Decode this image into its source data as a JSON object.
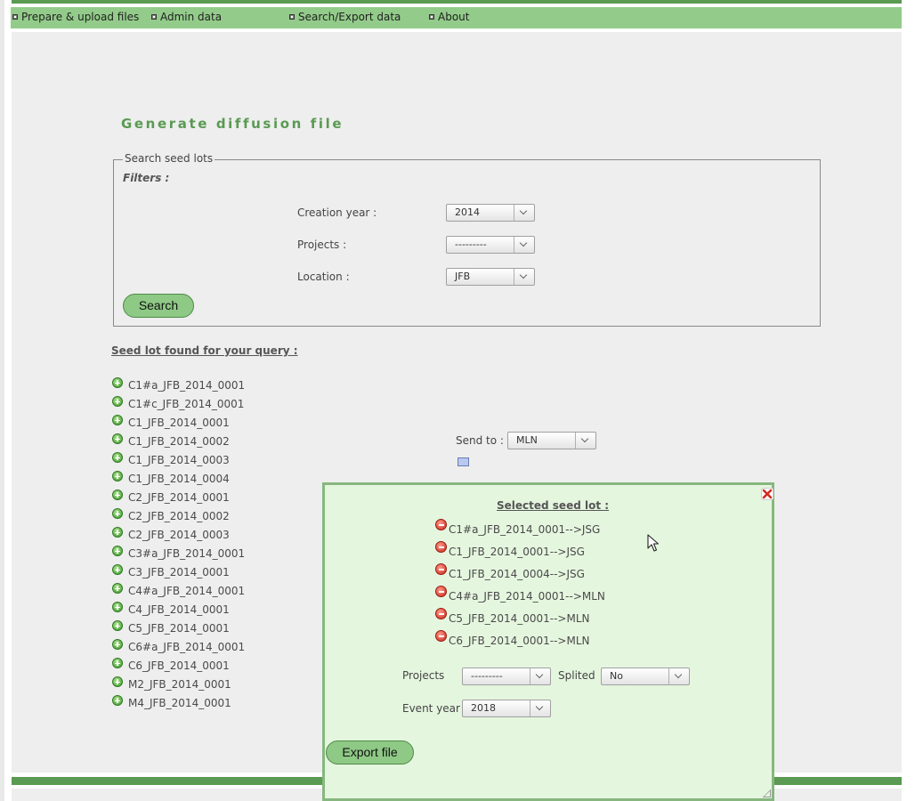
{
  "menu": {
    "items": [
      {
        "label": "Prepare & upload files"
      },
      {
        "label": "Admin data"
      },
      {
        "label": "Search/Export data"
      },
      {
        "label": "About"
      }
    ]
  },
  "page": {
    "title": "Generate diffusion file"
  },
  "search_panel": {
    "legend": "Search seed lots",
    "filters_label": "Filters :",
    "creation_year": {
      "label": "Creation year :",
      "value": "2014"
    },
    "projects": {
      "label": "Projects :",
      "value": "---------"
    },
    "location": {
      "label": "Location :",
      "value": "JFB"
    },
    "search_button": "Search"
  },
  "results": {
    "label": "Seed lot found for your query :",
    "seed_lots": [
      "C1#a_JFB_2014_0001",
      "C1#c_JFB_2014_0001",
      "C1_JFB_2014_0001",
      "C1_JFB_2014_0002",
      "C1_JFB_2014_0003",
      "C1_JFB_2014_0004",
      "C2_JFB_2014_0001",
      "C2_JFB_2014_0002",
      "C2_JFB_2014_0003",
      "C3#a_JFB_2014_0001",
      "C3_JFB_2014_0001",
      "C4#a_JFB_2014_0001",
      "C4_JFB_2014_0001",
      "C5_JFB_2014_0001",
      "C6#a_JFB_2014_0001",
      "C6_JFB_2014_0001",
      "M2_JFB_2014_0001",
      "M4_JFB_2014_0001"
    ]
  },
  "send_to": {
    "label": "Send to :",
    "value": "MLN"
  },
  "dialog": {
    "title": "Selected seed lot :",
    "selected": [
      "C1#a_JFB_2014_0001-->JSG",
      "C1_JFB_2014_0001-->JSG",
      "C1_JFB_2014_0004-->JSG",
      "C4#a_JFB_2014_0001-->MLN",
      "C5_JFB_2014_0001-->MLN",
      "C6_JFB_2014_0001-->MLN"
    ],
    "projects": {
      "label": "Projects",
      "value": "---------"
    },
    "splited": {
      "label": "Splited",
      "value": "No"
    },
    "event_year": {
      "label": "Event year",
      "value": "2018"
    },
    "export_button": "Export file"
  },
  "colors": {
    "menu_bg": "#93cc8a",
    "accent": "#5a9a52",
    "dialog_bg": "#e5f6df"
  }
}
